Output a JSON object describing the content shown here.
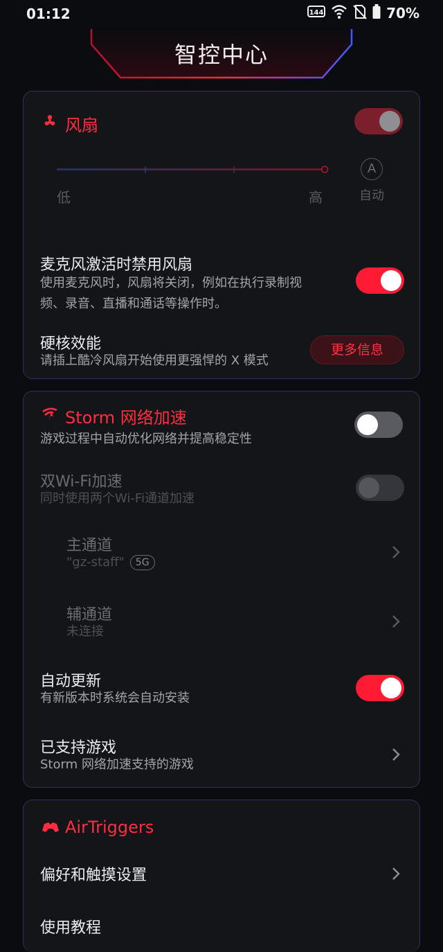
{
  "status": {
    "time": "01:12",
    "battery": "70%",
    "refresh_badge": "144"
  },
  "header": {
    "title": "智控中心"
  },
  "fan": {
    "title": "风扇",
    "toggle_on": true,
    "slider": {
      "low": "低",
      "high": "高",
      "auto_icon": "A",
      "auto_label": "自动",
      "level": 1.0
    },
    "mic": {
      "label": "麦克风激活时禁用风扇",
      "desc_line1": "使用麦克风时，风扇将关闭，例如在执行录制视",
      "desc_line2": "频、录音、直播和通话等操作时。",
      "toggle_on": true
    },
    "hardcore": {
      "label": "硬核效能",
      "desc": "请插上酷冷风扇开始使用更强悍的 X 模式",
      "button": "更多信息"
    }
  },
  "storm": {
    "title": "Storm 网络加速",
    "desc": "游戏过程中自动优化网络并提高稳定性",
    "toggle_on": false,
    "dual_wifi": {
      "label": "双Wi-Fi加速",
      "desc": "同时使用两个Wi-Fi通道加速",
      "toggle_on": false
    },
    "primary": {
      "label": "主通道",
      "value": "\"gz-staff\"",
      "badge": "5G"
    },
    "secondary": {
      "label": "辅通道",
      "value": "未连接"
    },
    "auto_update": {
      "label": "自动更新",
      "desc": "有新版本时系统会自动安装",
      "toggle_on": true
    },
    "supported": {
      "label": "已支持游戏",
      "desc": "Storm 网络加速支持的游戏"
    }
  },
  "airtriggers": {
    "title": "AirTriggers",
    "pref": {
      "label": "偏好和触摸设置"
    },
    "tutorial": {
      "label": "使用教程"
    }
  },
  "colors": {
    "accent": "#ff1b33",
    "background": "#0b0c10",
    "card": "#141519",
    "card_border": "#3a2b5c"
  }
}
